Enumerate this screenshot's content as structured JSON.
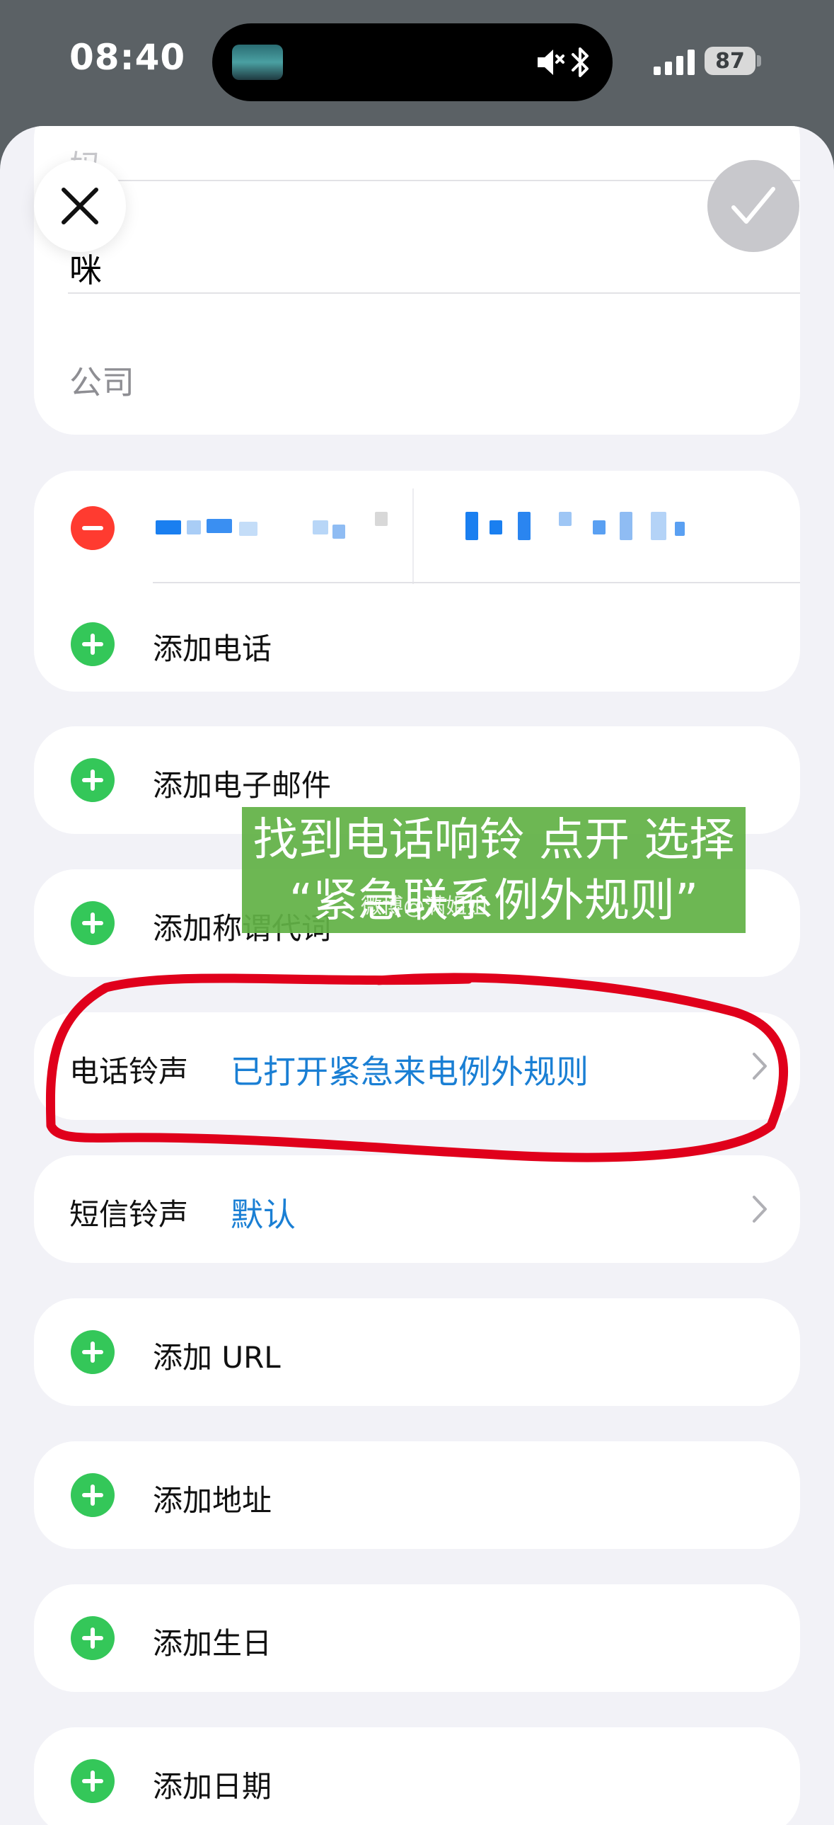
{
  "status_bar": {
    "time": "08:40",
    "battery": "87"
  },
  "contact": {
    "last_name": "妈",
    "first_name": "咪",
    "company_placeholder": "公司"
  },
  "phone": {
    "add_label": "添加电话"
  },
  "email": {
    "add_label": "添加电子邮件"
  },
  "pronoun": {
    "add_label": "添加称谓代词"
  },
  "ringtone": {
    "label": "电话铃声",
    "value": "已打开紧急来电例外规则"
  },
  "text_tone": {
    "label": "短信铃声",
    "value": "默认"
  },
  "url": {
    "add_label": "添加 URL"
  },
  "address": {
    "add_label": "添加地址"
  },
  "birthday": {
    "add_label": "添加生日"
  },
  "date": {
    "add_label": "添加日期"
  },
  "annotation": {
    "caption_line1": "找到电话响铃 点开 选择",
    "caption_line2": "“紧急联系例外规则”",
    "watermark": "微博@满姐姐"
  },
  "colors": {
    "accent_blue": "#1a7fd4",
    "add_green": "#34c759",
    "delete_red": "#ff3b30",
    "annotation_red": "#e0001b",
    "caption_green": "#62b246"
  },
  "icons": [
    "close-icon",
    "checkmark-icon",
    "speaker-icon",
    "bluetooth-icon",
    "cellular-icon",
    "battery-icon",
    "plus-icon",
    "minus-icon",
    "chevron-right-icon"
  ]
}
